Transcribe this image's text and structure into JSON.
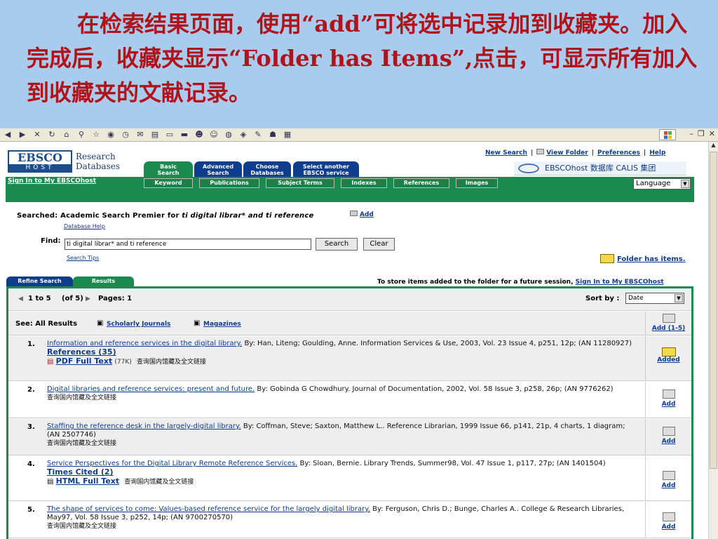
{
  "caption": {
    "text": "在检索结果页面，使用“add”可将选中记录加到收藏夹。加入完成后，收藏夹显示“Folder has Items”,点击，可显示所有加入到收藏夹的文献记录。"
  },
  "ebsco": {
    "logo_top": "EBSCO",
    "logo_bottom": "HOST",
    "research_databases": "Research\nDatabases"
  },
  "tabs": {
    "basic": "Basic\nSearch",
    "advanced": "Advanced\nSearch",
    "choose": "Choose\nDatabases",
    "select": "Select another\nEBSCO service"
  },
  "toplinks": {
    "new_search": "New Search",
    "view_folder": "View Folder",
    "preferences": "Preferences",
    "help": "Help"
  },
  "calis": "EBSCOhost 数据库 CALIS 集团",
  "signin": "Sign In to My EBSCOhost",
  "subtabs": [
    "Keyword",
    "Publications",
    "Subject Terms",
    "Indexes",
    "References",
    "Images"
  ],
  "language": "Language",
  "search": {
    "searched_prefix": "Searched: Academic Search Premier for ",
    "searched_query": "ti digital librar* and ti reference",
    "add": "Add",
    "database_help": "Database Help",
    "find_label": "Find:",
    "find_value": "ti digital librar* and ti reference",
    "search_button": "Search",
    "clear_button": "Clear",
    "search_tips": "Search Tips",
    "folder_has_items": "Folder has items."
  },
  "result_tabs": {
    "refine": "Refine Search",
    "results": "Results"
  },
  "store_msg": {
    "text": "To store items added to the folder for a future session, ",
    "link": "Sign In to My EBSCOhost"
  },
  "results": {
    "range": "1 to 5",
    "of": "(of 5)",
    "pages": "Pages: 1",
    "sort_label": "Sort by :",
    "sort_value": "Date",
    "see_all": "See: All Results",
    "scholarly": "Scholarly Journals",
    "magazines": "Magazines",
    "add_all": "Add (1-5)",
    "added": "Added",
    "add": "Add",
    "cn_link": "查询国内馆藏及全文链接",
    "items": [
      {
        "num": "1.",
        "title": "Information and reference services in the digital library.",
        "rest": " By: Han, Liteng; Goulding, Anne. Information Services & Use, 2003, Vol. 23 Issue 4, p251, 12p; (AN 11280927)",
        "refs": "References (35)",
        "full": "PDF Full Text",
        "size": "(77K)"
      },
      {
        "num": "2.",
        "title": "Digital libraries and reference services: present and future.",
        "rest": " By: Gobinda G Chowdhury. Journal of Documentation, 2002, Vol. 58 Issue 3, p258, 26p; (AN 9776262)"
      },
      {
        "num": "3.",
        "title": "Staffing the reference desk in the largely-digital library.",
        "rest": " By: Coffman, Steve; Saxton, Matthew L.. Reference Librarian, 1999 Issue 66, p141, 21p, 4 charts, 1 diagram; (AN 2507746)"
      },
      {
        "num": "4.",
        "title": "Service Perspectives for the Digital Library Remote Reference Services.",
        "rest": " By: Sloan, Bernie. Library Trends, Summer98, Vol. 47 Issue 1, p117, 27p; (AN 1401504)",
        "refs": "Times Cited (2)",
        "full": "HTML Full Text"
      },
      {
        "num": "5.",
        "title": "The shape of services to come: Values-based reference service for the largely digital library.",
        "rest": " By: Ferguson, Chris D.; Bunge, Charles A.. College & Research Libraries, May97, Vol. 58 Issue 3, p252, 14p; (AN 9700270570)"
      }
    ]
  }
}
